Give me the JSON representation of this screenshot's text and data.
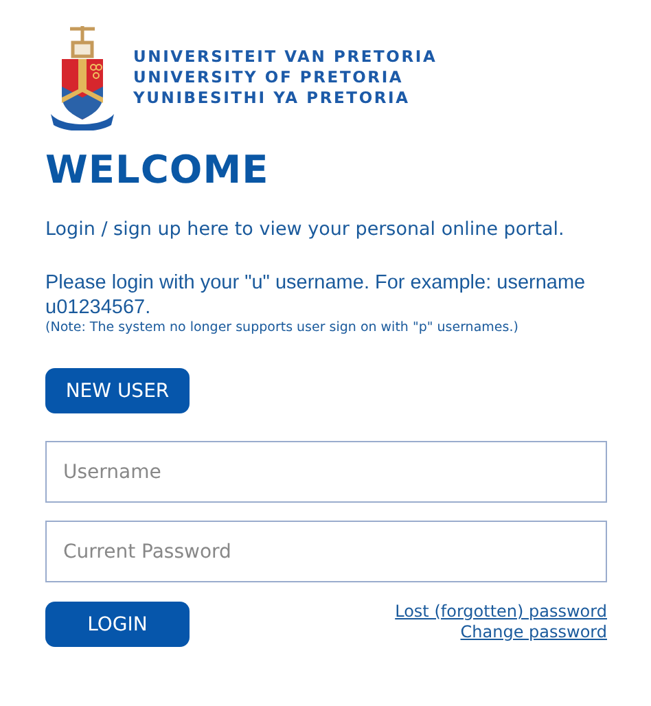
{
  "logo": {
    "lines": [
      "UNIVERSITEIT VAN PRETORIA",
      "UNIVERSITY OF PRETORIA",
      "YUNIBESITHI YA PRETORIA"
    ]
  },
  "heading": "WELCOME",
  "intro": "Login / sign up here to view your personal online portal.",
  "instructions": "Please login with your \"u\" username. For example: username u01234567.",
  "note": "(Note: The system no longer supports user sign on with \"p\" usernames.)",
  "new_user_button": "NEW USER",
  "fields": [
    {
      "placeholder": "Username"
    },
    {
      "placeholder": "Current Password"
    }
  ],
  "login_button": "LOGIN",
  "links": [
    "Lost (forgotten) password",
    "Change password"
  ]
}
